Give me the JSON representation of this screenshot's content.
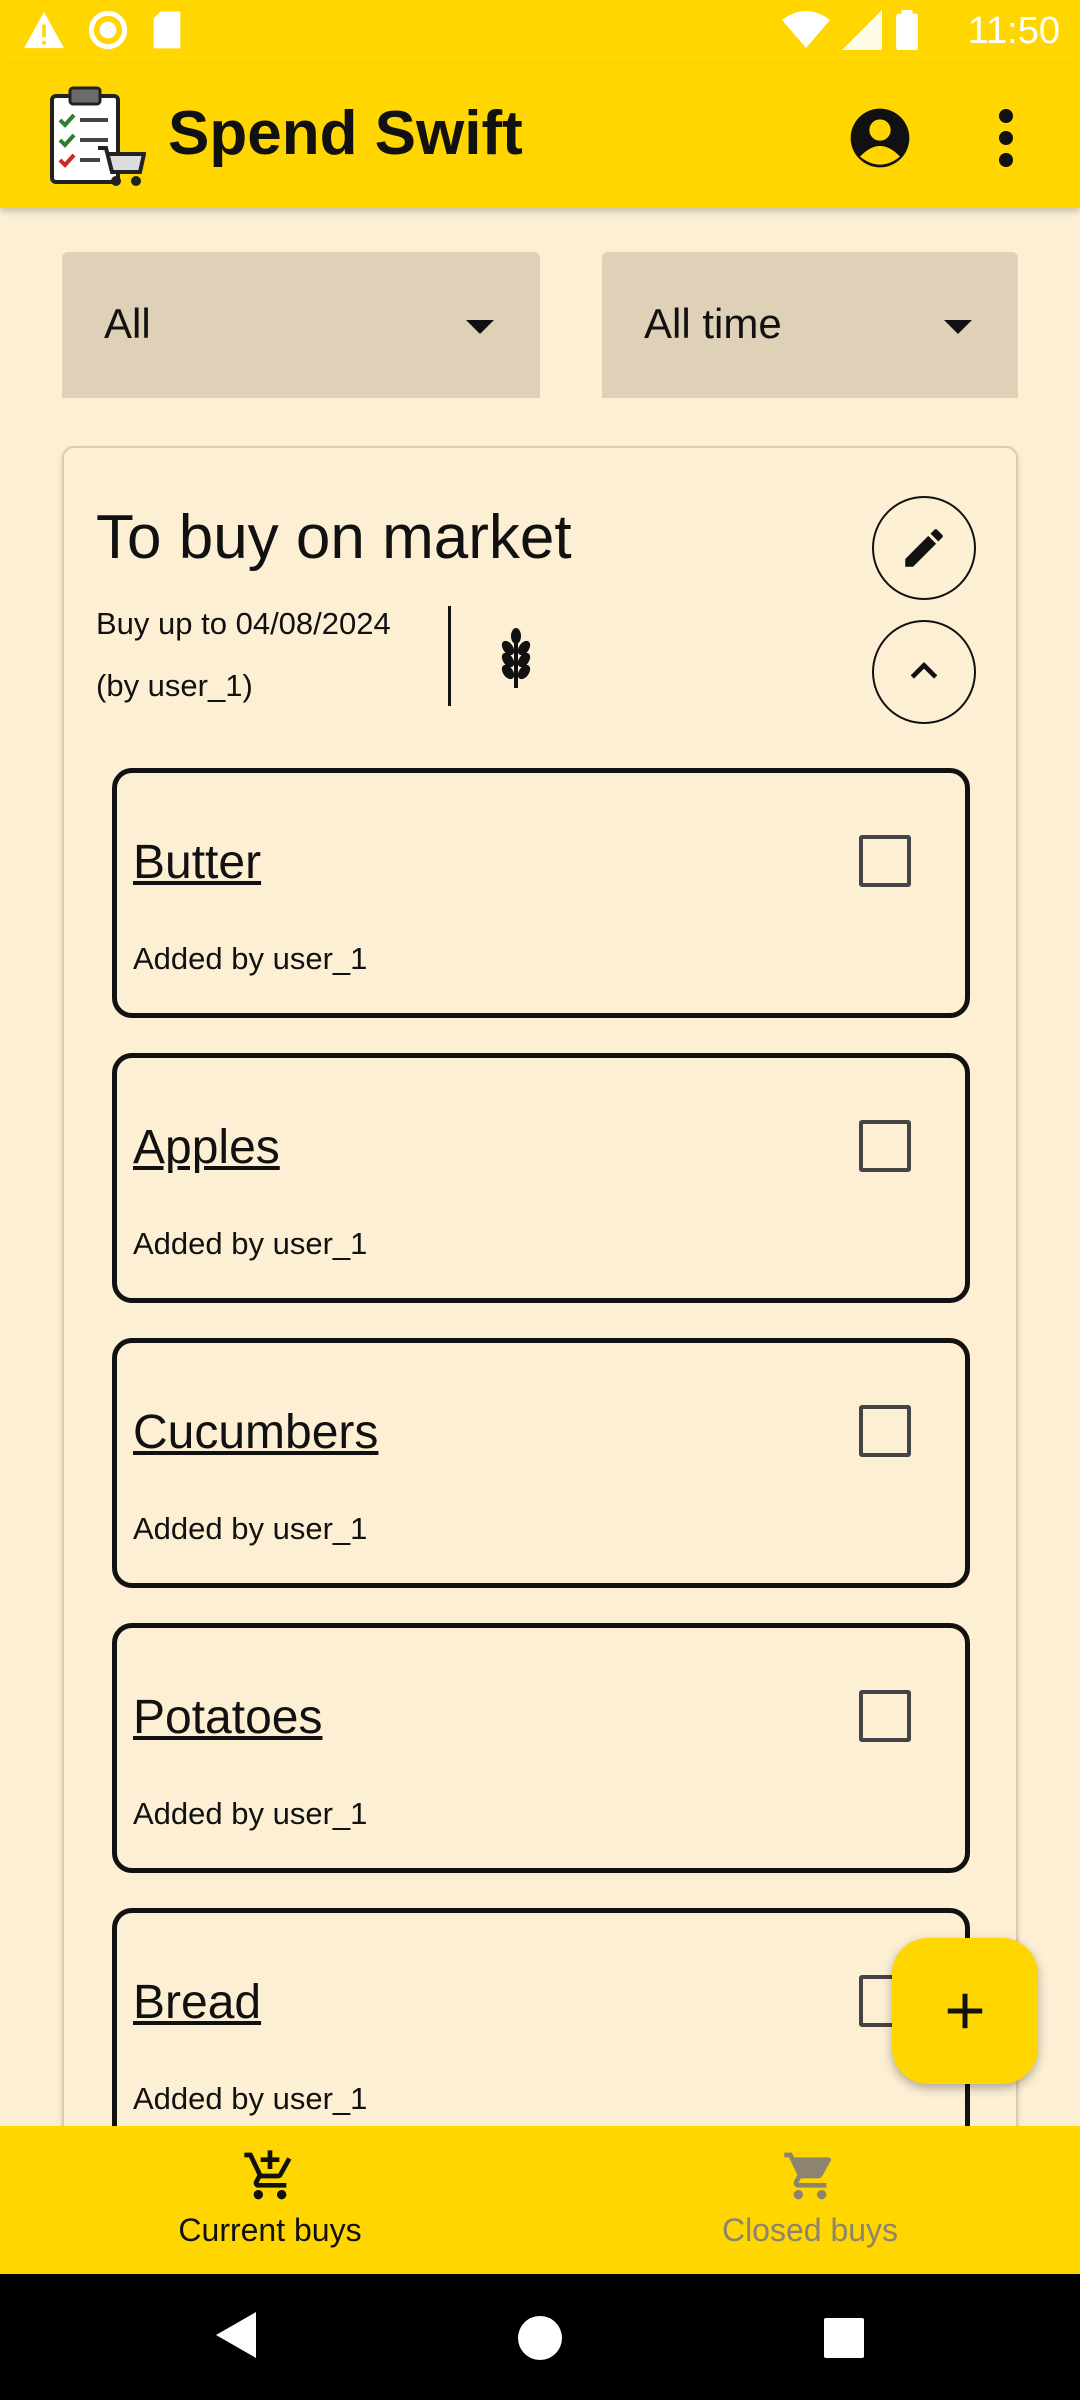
{
  "status_bar": {
    "time": "11:50"
  },
  "app_bar": {
    "title": "Spend Swift"
  },
  "filters": {
    "category": "All",
    "period": "All time"
  },
  "list_card": {
    "title": "To buy on market",
    "deadline": "Buy up to 04/08/2024",
    "author": "(by user_1)",
    "items": [
      {
        "name": "Butter",
        "meta": "Added by user_1",
        "checked": false
      },
      {
        "name": "Apples",
        "meta": "Added by user_1",
        "checked": false
      },
      {
        "name": "Cucumbers",
        "meta": "Added by user_1",
        "checked": false
      },
      {
        "name": "Potatoes",
        "meta": "Added by user_1",
        "checked": false
      },
      {
        "name": "Bread",
        "meta": "Added by user_1",
        "checked": false
      }
    ]
  },
  "bottom_nav": {
    "current": "Current buys",
    "closed": "Closed buys"
  },
  "icons": {
    "edit": "pencil-icon",
    "collapse": "chevron-up-icon",
    "category": "wheat-icon",
    "add": "plus-icon"
  },
  "colors": {
    "accent": "#ffd600",
    "background": "#fcefd4",
    "filter_bg": "#ded1b8"
  }
}
